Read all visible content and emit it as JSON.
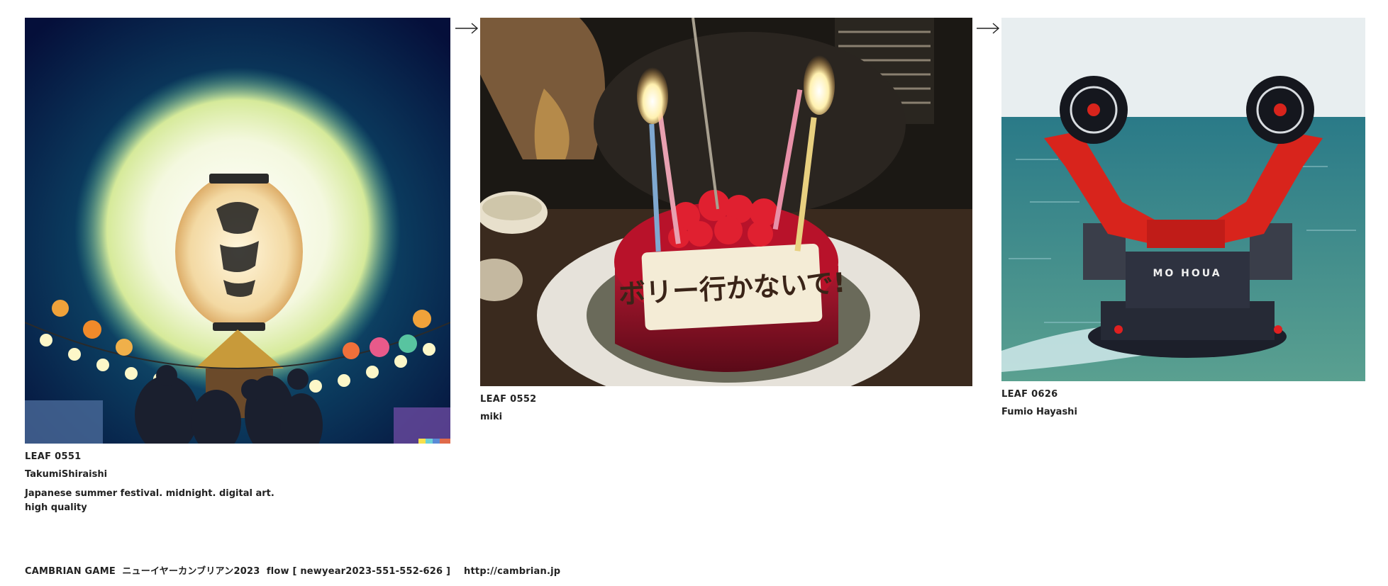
{
  "leaves": [
    {
      "code": "LEAF 0551",
      "author": "TakumiShiraishi",
      "prompt": "Japanese summer festival. midnight. digital art. high quality"
    },
    {
      "code": "LEAF 0552",
      "author": "miki"
    },
    {
      "code": "LEAF 0626",
      "author": "Fumio Hayashi"
    }
  ],
  "footer": {
    "text": "CAMBRIAN GAME  ニューイヤーカンブリアン2023  flow [ newyear2023-551-552-626 ]    http://cambrian.jp"
  },
  "cake_plaque_text": "ボリー行かないで!",
  "robot_text": "MO HOUA"
}
